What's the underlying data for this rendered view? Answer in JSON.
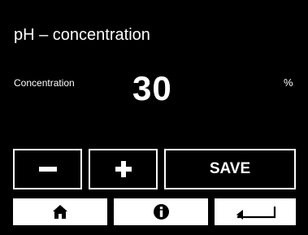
{
  "screen": {
    "title": "pH – concentration",
    "concentration_label": "Concentration",
    "concentration_value": "30",
    "unit": "%"
  },
  "buttons": {
    "decrease_icon": "minus-icon",
    "increase_icon": "plus-icon",
    "save_label": "SAVE"
  },
  "nav": {
    "home_icon": "home-icon",
    "info_icon": "info-icon",
    "back_icon": "back-arrow-icon"
  },
  "colors": {
    "background": "#000000",
    "foreground": "#ffffff"
  }
}
